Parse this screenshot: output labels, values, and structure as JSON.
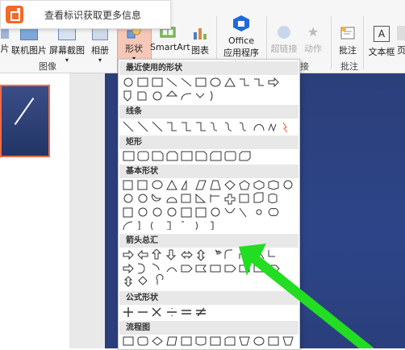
{
  "tooltip": {
    "text": "查看标识获取更多信息"
  },
  "ribbon": {
    "tools": [
      {
        "id": "pic",
        "label": "片"
      },
      {
        "id": "online",
        "label": "联机图片"
      },
      {
        "id": "screenshot",
        "label": "屏幕截图"
      },
      {
        "id": "album",
        "label": "相册"
      },
      {
        "id": "shapes",
        "label": "形状"
      },
      {
        "id": "smartart",
        "label": "SmartArt"
      },
      {
        "id": "chart",
        "label": "图表"
      },
      {
        "id": "office",
        "label": "Office"
      },
      {
        "id": "office2",
        "label": "应用程序"
      },
      {
        "id": "link",
        "label": "超链接"
      },
      {
        "id": "action",
        "label": "动作"
      },
      {
        "id": "comment",
        "label": "批注"
      },
      {
        "id": "textbox",
        "label": "文本框"
      },
      {
        "id": "header",
        "label": "页"
      }
    ],
    "groups": {
      "images": "图像",
      "links": "接",
      "comments": "批注"
    }
  },
  "dropdown": {
    "sections": [
      {
        "id": "recent",
        "title": "最近使用的形状"
      },
      {
        "id": "lines",
        "title": "线条"
      },
      {
        "id": "rect",
        "title": "矩形"
      },
      {
        "id": "basic",
        "title": "基本形状"
      },
      {
        "id": "arrows",
        "title": "箭头总汇"
      },
      {
        "id": "formula",
        "title": "公式形状"
      },
      {
        "id": "flow",
        "title": "流程图"
      }
    ]
  },
  "colors": {
    "accent": "#f06b45",
    "arrow": "#22dd22",
    "slide": "#2b3f7a"
  }
}
